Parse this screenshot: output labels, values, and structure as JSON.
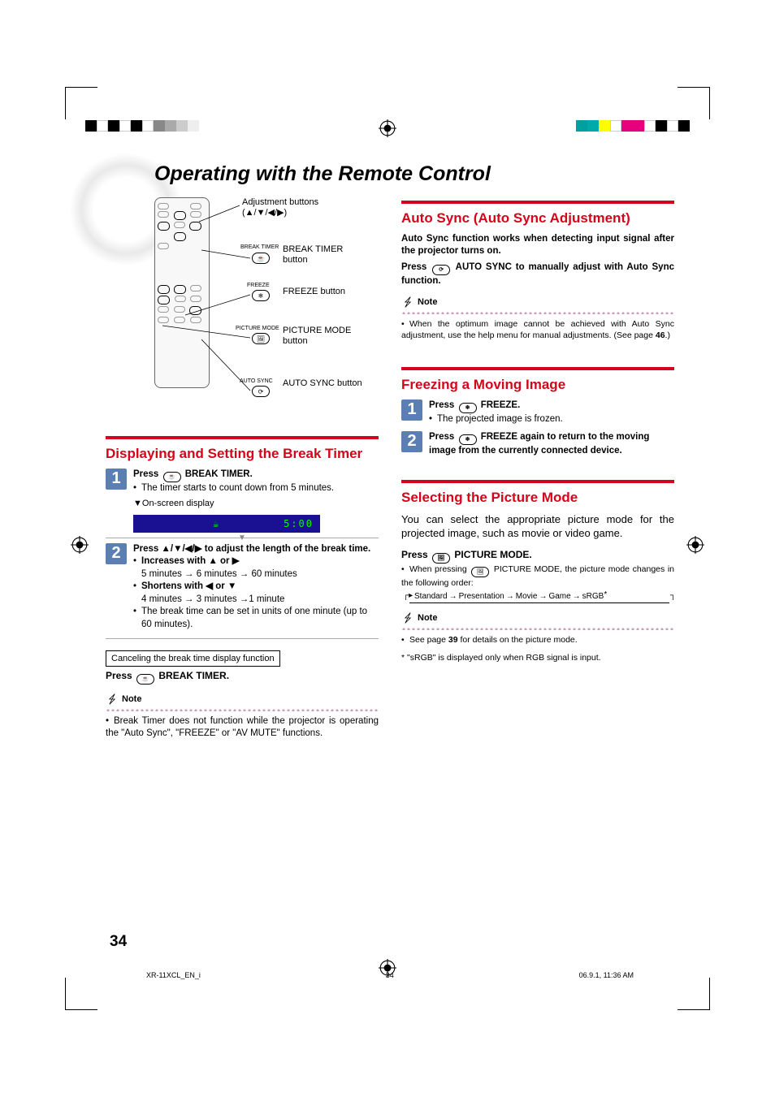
{
  "domain": "Document",
  "title": "Operating with the Remote Control",
  "diagram": {
    "adjustment_label": "Adjustment buttons",
    "adjustment_symbols": "(▲/▼/◀/▶)",
    "break_timer_caption": "BREAK TIMER",
    "break_timer_label": "BREAK TIMER button",
    "freeze_caption": "FREEZE",
    "freeze_label": "FREEZE button",
    "picture_mode_caption": "PICTURE MODE",
    "picture_mode_label": "PICTURE MODE button",
    "auto_sync_caption": "AUTO SYNC",
    "auto_sync_label": "AUTO SYNC button"
  },
  "left": {
    "section_title": "Displaying and Setting the Break Timer",
    "step1_head": "Press ⓘ BREAK TIMER.",
    "step1_b1": "The timer starts to count down from 5 minutes.",
    "step1_osd_label": "▼On-screen display",
    "osd_value": "5:00",
    "step2_head": "Press ▲/▼/◀/▶ to adjust the length of the break time.",
    "step2_inc_head": "Increases with ▲ or ▶",
    "step2_inc_body": "5 minutes → 6 minutes → 60 minutes",
    "step2_dec_head": "Shortens with ◀ or ▼",
    "step2_dec_body": "4 minutes → 3 minutes →1 minute",
    "step2_b3": "The break time can be set in units of one minute (up to 60 minutes).",
    "cancel_box": "Canceling the break time display function",
    "cancel_line": "Press ⓘ BREAK TIMER.",
    "note_label": "Note",
    "note_body": "Break Timer does not function while the projector is operating the \"Auto Sync\", \"FREEZE\" or \"AV MUTE\" functions."
  },
  "right": {
    "auto_sync_title": "Auto Sync (Auto Sync Adjustment)",
    "auto_sync_p1": "Auto Sync function works when detecting input signal after the projector turns on.",
    "auto_sync_p2a": "Press ",
    "auto_sync_p2b": " AUTO SYNC to manually adjust with Auto Sync function.",
    "as_note_label": "Note",
    "as_note_b1a": "When the optimum image cannot be achieved with Auto Sync adjustment, use the help menu for manual adjustments. (See page ",
    "as_note_b1b": "46",
    "as_note_b1c": ".)",
    "freeze_title": "Freezing a Moving Image",
    "freeze_step1_head": "Press ⓘ FREEZE.",
    "freeze_step1_b1": "The projected image is frozen.",
    "freeze_step2_head": "Press ⓘ FREEZE again to return to the moving image from the currently connected device.",
    "picture_title": "Selecting the Picture Mode",
    "picture_intro": "You can select the appropriate picture mode for the projected image, such as movie or video game.",
    "picture_press": "Press ⓘ PICTURE MODE.",
    "picture_b1": "When pressing ⓘ PICTURE MODE, the picture mode changes in the following order:",
    "cycle": {
      "a": "Standard",
      "b": "Presentation",
      "c": "Movie",
      "d": "Game",
      "e": "sRGB"
    },
    "pic_note_label": "Note",
    "pic_note_b1a": "See page ",
    "pic_note_b1b": "39",
    "pic_note_b1c": " for details on the picture mode.",
    "srgb_foot": "* \"sRGB\" is displayed only when RGB signal is input."
  },
  "page_number": "34",
  "footer": {
    "left": "XR-11XCL_EN_i",
    "center": "34",
    "right": "06.9.1, 11:36 AM"
  }
}
